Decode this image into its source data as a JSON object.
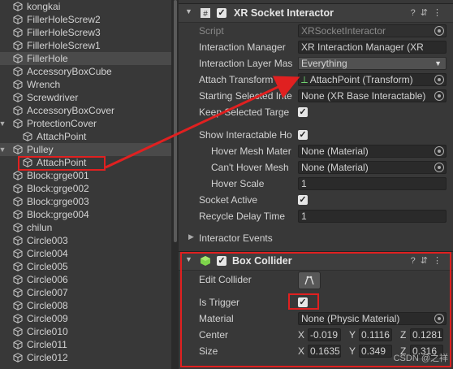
{
  "hierarchy": [
    {
      "label": "kongkai",
      "indent": 0,
      "arrow": false,
      "selected": false
    },
    {
      "label": "FillerHoleScrew2",
      "indent": 0,
      "arrow": false,
      "selected": false
    },
    {
      "label": "FillerHoleScrew3",
      "indent": 0,
      "arrow": false,
      "selected": false
    },
    {
      "label": "FillerHoleScrew1",
      "indent": 0,
      "arrow": false,
      "selected": false
    },
    {
      "label": "FillerHole",
      "indent": 0,
      "arrow": false,
      "selected": true
    },
    {
      "label": "AccessoryBoxCube",
      "indent": 0,
      "arrow": false,
      "selected": false
    },
    {
      "label": "Wrench",
      "indent": 0,
      "arrow": false,
      "selected": false
    },
    {
      "label": "Screwdriver",
      "indent": 0,
      "arrow": false,
      "selected": false
    },
    {
      "label": "AccessoryBoxCover",
      "indent": 0,
      "arrow": false,
      "selected": false
    },
    {
      "label": "ProtectionCover",
      "indent": 0,
      "arrow": true,
      "selected": false
    },
    {
      "label": "AttachPoint",
      "indent": 1,
      "arrow": false,
      "selected": false
    },
    {
      "label": "Pulley",
      "indent": 0,
      "arrow": true,
      "selected": true
    },
    {
      "label": "AttachPoint",
      "indent": 1,
      "arrow": false,
      "selected": false
    },
    {
      "label": "Block:grge001",
      "indent": 0,
      "arrow": false,
      "selected": false
    },
    {
      "label": "Block:grge002",
      "indent": 0,
      "arrow": false,
      "selected": false
    },
    {
      "label": "Block:grge003",
      "indent": 0,
      "arrow": false,
      "selected": false
    },
    {
      "label": "Block:grge004",
      "indent": 0,
      "arrow": false,
      "selected": false
    },
    {
      "label": "chilun",
      "indent": 0,
      "arrow": false,
      "selected": false
    },
    {
      "label": "Circle003",
      "indent": 0,
      "arrow": false,
      "selected": false
    },
    {
      "label": "Circle004",
      "indent": 0,
      "arrow": false,
      "selected": false
    },
    {
      "label": "Circle005",
      "indent": 0,
      "arrow": false,
      "selected": false
    },
    {
      "label": "Circle006",
      "indent": 0,
      "arrow": false,
      "selected": false
    },
    {
      "label": "Circle007",
      "indent": 0,
      "arrow": false,
      "selected": false
    },
    {
      "label": "Circle008",
      "indent": 0,
      "arrow": false,
      "selected": false
    },
    {
      "label": "Circle009",
      "indent": 0,
      "arrow": false,
      "selected": false
    },
    {
      "label": "Circle010",
      "indent": 0,
      "arrow": false,
      "selected": false
    },
    {
      "label": "Circle011",
      "indent": 0,
      "arrow": false,
      "selected": false
    },
    {
      "label": "Circle012",
      "indent": 0,
      "arrow": false,
      "selected": false
    }
  ],
  "xr": {
    "title": "XR Socket Interactor",
    "script_label": "Script",
    "script_value": "XRSocketInteractor",
    "im_label": "Interaction Manager",
    "im_value": "XR Interaction Manager (XR",
    "ilm_label": "Interaction Layer Mas",
    "ilm_value": "Everything",
    "attach_label": "Attach Transform",
    "attach_value": "AttachPoint (Transform)",
    "start_label": "Starting Selected Inte",
    "start_value": "None (XR Base Interactable)",
    "keep_label": "Keep Selected Targe",
    "show_label": "Show Interactable Ho",
    "hover_mesh_label": "Hover Mesh Mater",
    "hover_mesh_value": "None (Material)",
    "cant_label": "Can't Hover Mesh",
    "cant_value": "None (Material)",
    "scale_label": "Hover Scale",
    "scale_value": "1",
    "socket_label": "Socket Active",
    "delay_label": "Recycle Delay Time",
    "delay_value": "1",
    "events_label": "Interactor Events"
  },
  "box": {
    "title": "Box Collider",
    "edit_label": "Edit Collider",
    "trigger_label": "Is Trigger",
    "material_label": "Material",
    "material_value": "None (Physic Material)",
    "center_label": "Center",
    "center_x": "-0.019",
    "center_y": "0.1116",
    "center_z": "0.1281",
    "size_label": "Size",
    "size_x": "0.1635",
    "size_y": "0.349",
    "size_z": "0.316"
  },
  "watermark": "CSDN @之祥",
  "colors": {
    "highlight": "#e02020"
  }
}
